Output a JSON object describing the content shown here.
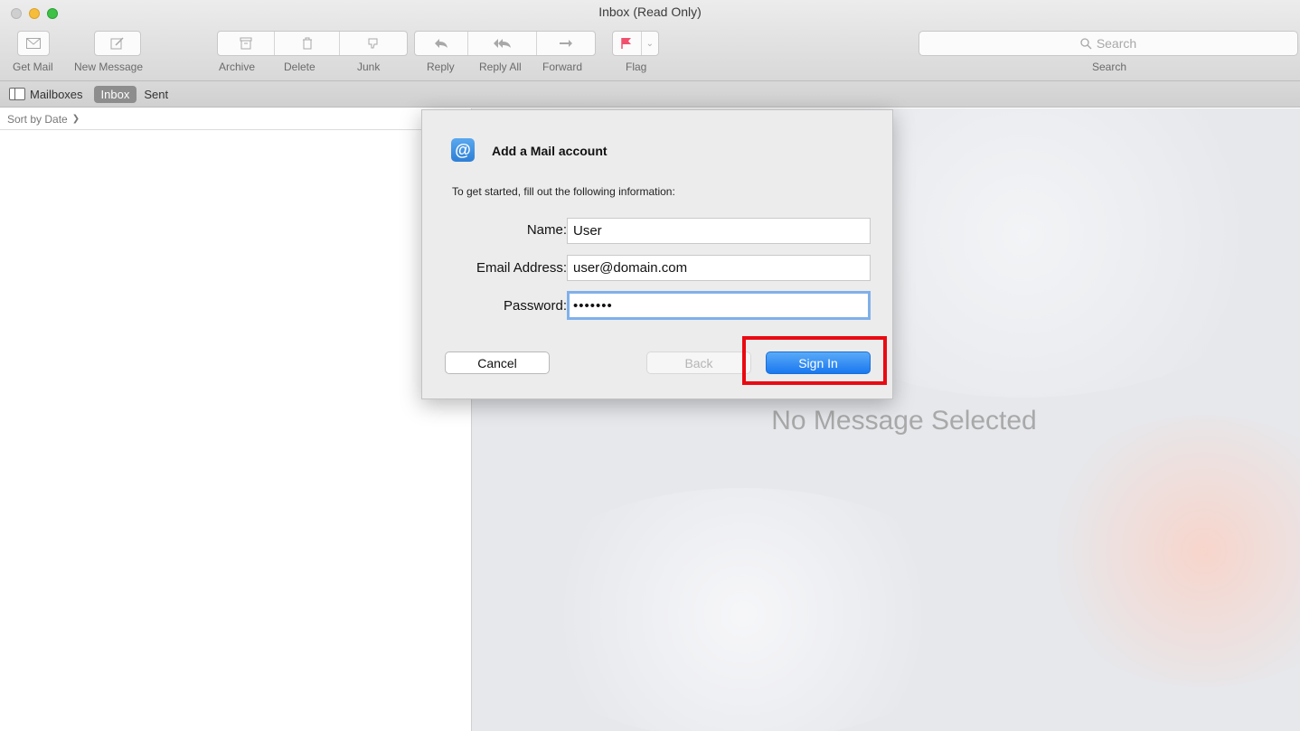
{
  "window": {
    "title": "Inbox (Read Only)"
  },
  "toolbar": {
    "get_mail": "Get Mail",
    "new_message": "New Message",
    "archive": "Archive",
    "delete": "Delete",
    "junk": "Junk",
    "reply": "Reply",
    "reply_all": "Reply All",
    "forward": "Forward",
    "flag": "Flag",
    "search_placeholder": "Search",
    "search_label": "Search",
    "flag_color": "#f0506e"
  },
  "favorites": {
    "mailboxes": "Mailboxes",
    "inbox": "Inbox",
    "sent": "Sent"
  },
  "message_list": {
    "sort": "Sort by Date"
  },
  "reading_pane": {
    "empty_text": "No Message Selected"
  },
  "dialog": {
    "title": "Add a Mail account",
    "subtitle": "To get started, fill out the following information:",
    "name_label": "Name:",
    "name_value": "User",
    "email_label": "Email Address:",
    "email_value": "user@domain.com",
    "password_label": "Password:",
    "password_value": "•••••••",
    "cancel": "Cancel",
    "back": "Back",
    "sign_in": "Sign In",
    "accent": "#1a78f0",
    "highlight_color": "#ea0a12"
  }
}
